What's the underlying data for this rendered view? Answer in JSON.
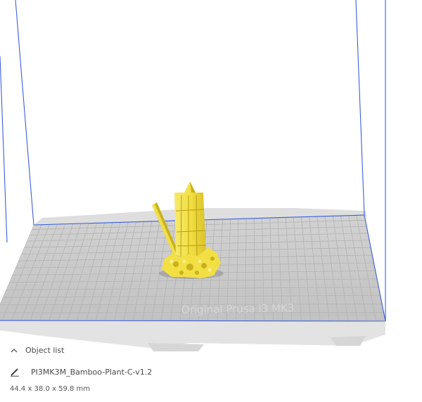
{
  "viewport": {
    "label": "3D print preview viewport",
    "build_plate_watermark": "Original Prusa i3 MK3",
    "colors": {
      "grid_line": "#b7b7b7",
      "plate": "#c8c8c8",
      "volume_edge": "#3d5fd8",
      "model": "#f2e25b",
      "model_shade": "#c9b11b"
    }
  },
  "object_panel": {
    "title": "Object list",
    "toggle_icon": "chevron-up-icon",
    "object_icon": "pencil-icon",
    "object_name": "PI3MK3M_Bamboo-Plant-C-v1.2",
    "dimensions": "44.4 x 38.0 x 59.8 mm"
  }
}
